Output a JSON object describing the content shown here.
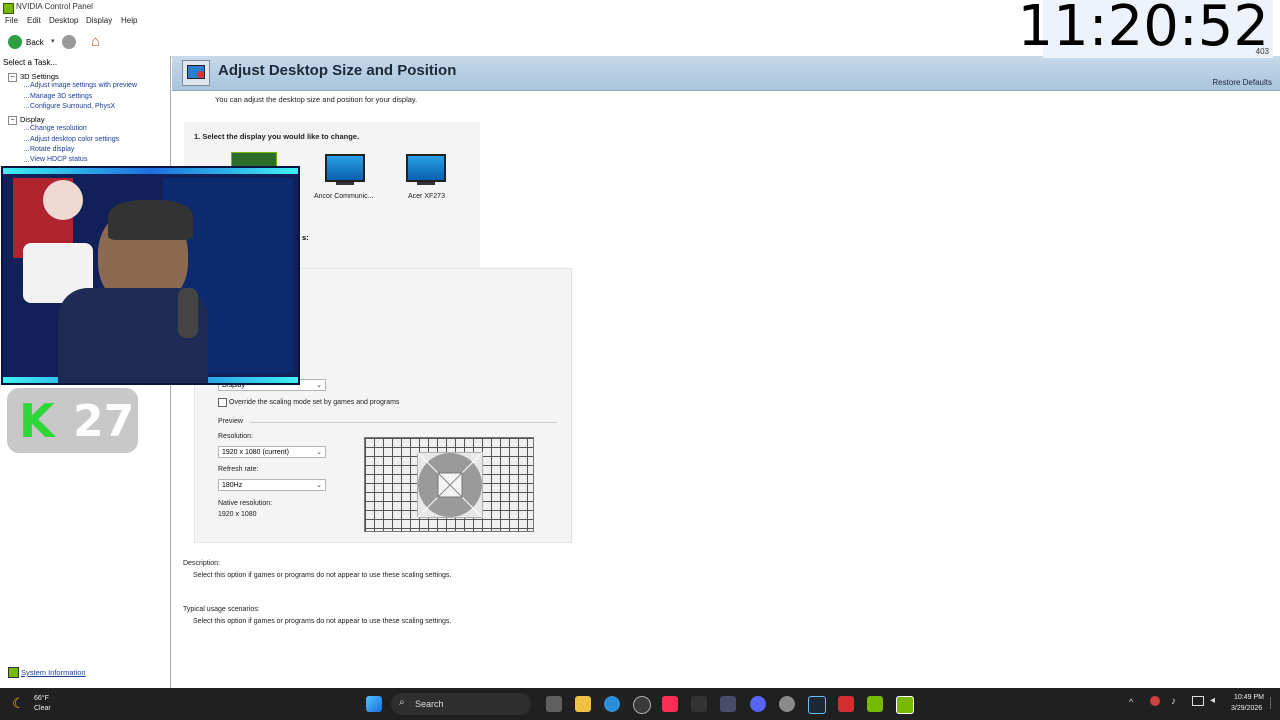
{
  "window": {
    "title": "NVIDIA Control Panel"
  },
  "menu": [
    "File",
    "Edit",
    "Desktop",
    "Display",
    "Help"
  ],
  "toolbar": {
    "back_label": "Back"
  },
  "sidebar": {
    "header": "Select a Task...",
    "categories": [
      {
        "label": "3D Settings",
        "items": [
          "Adjust image settings with preview",
          "Manage 3D settings",
          "Configure Surround, PhysX"
        ]
      },
      {
        "label": "Display",
        "items": [
          "Change resolution",
          "Adjust desktop color settings",
          "Rotate display",
          "View HDCP status"
        ]
      }
    ],
    "system_info": "System Information"
  },
  "overlay": {
    "badge_letter": "K",
    "badge_number": "27"
  },
  "page": {
    "title": "Adjust Desktop Size and Position",
    "restore_defaults": "Restore Defaults",
    "intro": "You can adjust the desktop size and position for your display.",
    "step1": "1. Select the display you would like to change.",
    "displays": [
      "Ancor Communic...",
      "Acer XF273"
    ],
    "step2_fragment": "s:",
    "scaling_dropdown": "Display",
    "override_label": "Override the scaling mode set by games and programs",
    "preview_label": "Preview",
    "resolution_label": "Resolution:",
    "resolution_value": "1920 x 1080 (current)",
    "refresh_label": "Refresh rate:",
    "refresh_value": "180Hz",
    "native_label": "Native resolution:",
    "native_value": "1920 x 1080",
    "description_label": "Description:",
    "description_text": "Select this option if games or programs do not appear to use these scaling settings.",
    "usage_label": "Typical usage scenarios:",
    "usage_text": "Select this option if games or programs do not appear to use these scaling settings."
  },
  "clock": {
    "time": "11:20:52",
    "sub": "403"
  },
  "taskbar": {
    "weather_temp": "66°F",
    "weather_cond": "Clear",
    "search_label": "Search",
    "time": "10:49 PM",
    "date": "3/29/2026"
  },
  "colors": {
    "nvidia_green": "#76b900",
    "link_blue": "#1a3fa0",
    "banner": "#b9cfe3",
    "taskbar": "#202020"
  }
}
